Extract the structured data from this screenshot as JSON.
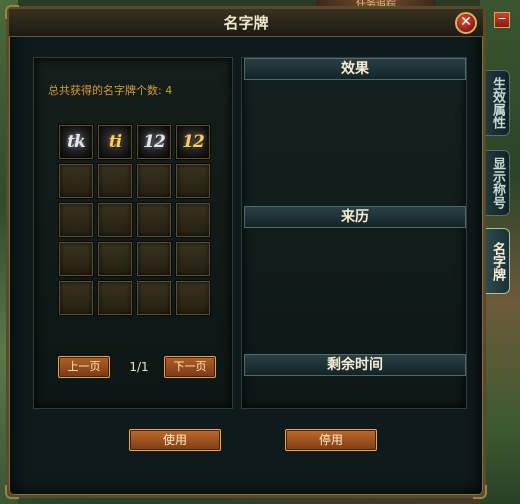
{
  "quest_tracker_label": "任务追踪",
  "window": {
    "title": "名字牌",
    "close_glyph": "✕"
  },
  "left_panel": {
    "count_text": "总共获得的名字牌个数: 4",
    "name_plates": [
      {
        "glyph": "tk",
        "style": "silver"
      },
      {
        "glyph": "ti",
        "style": "gold"
      },
      {
        "glyph": "12",
        "style": "silver"
      },
      {
        "glyph": "12",
        "style": "gold"
      }
    ],
    "empty_slots": 16,
    "pager": {
      "prev_label": "上一页",
      "page_text": "1/1",
      "next_label": "下一页"
    }
  },
  "right_panel": {
    "effect_header": "效果",
    "origin_header": "来历",
    "time_header": "剩余时间"
  },
  "buttons": {
    "use_label": "使用",
    "stop_label": "停用"
  },
  "side_tabs": [
    {
      "label": "生效属性",
      "active": false
    },
    {
      "label": "显示称号",
      "active": false
    },
    {
      "label": "名字牌",
      "active": true
    }
  ],
  "minimize_glyph": "−"
}
